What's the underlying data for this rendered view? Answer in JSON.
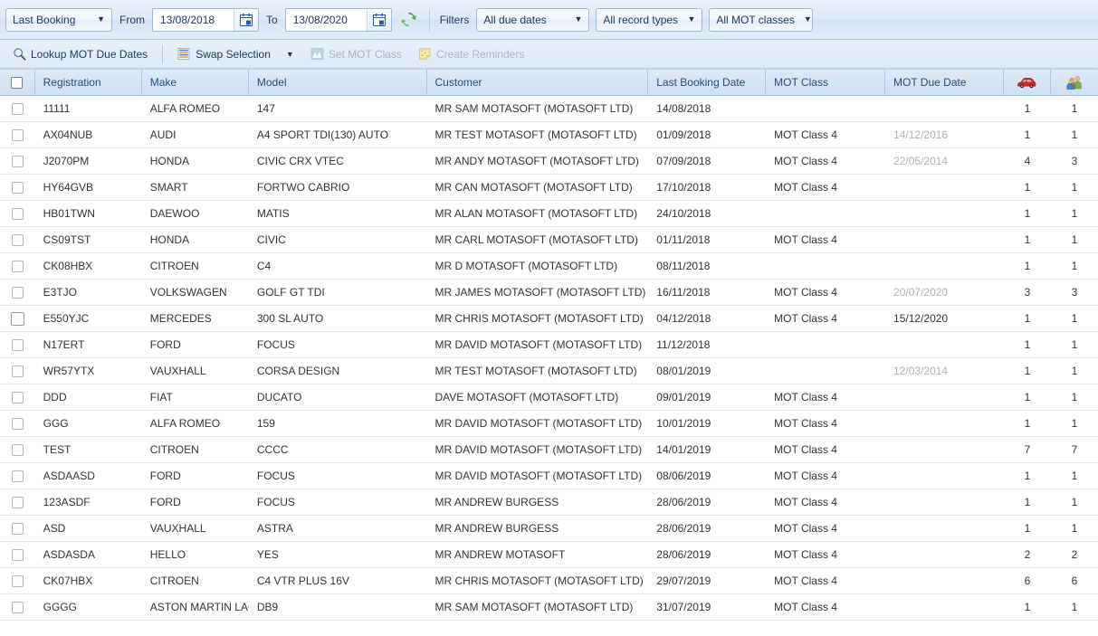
{
  "filter_bar": {
    "sort_by": {
      "value": "Last Booking",
      "icon": "chevron-down-icon"
    },
    "from_label": "From",
    "from_date": "13/08/2018",
    "to_label": "To",
    "to_date": "13/08/2020",
    "refresh_icon": "refresh-icon",
    "calendar_icon": "calendar-icon",
    "filters_label": "Filters",
    "filter_due_dates": "All due dates",
    "filter_record_types": "All record types",
    "filter_mot_classes": "All MOT classes"
  },
  "action_bar": {
    "lookup": {
      "label": "Lookup MOT Due Dates",
      "icon": "magnifier-icon",
      "disabled": false
    },
    "swap": {
      "label": "Swap Selection",
      "icon": "list-stack-icon",
      "disabled": false
    },
    "set_mot_class": {
      "label": "Set MOT Class",
      "icon": "mot-class-icon",
      "disabled": true
    },
    "create_reminders": {
      "label": "Create Reminders",
      "icon": "sticky-note-icon",
      "disabled": true
    }
  },
  "grid": {
    "columns": [
      {
        "key": "check",
        "label": "",
        "icon": "select-all-checkbox"
      },
      {
        "key": "registration",
        "label": "Registration"
      },
      {
        "key": "make",
        "label": "Make"
      },
      {
        "key": "model",
        "label": "Model"
      },
      {
        "key": "customer",
        "label": "Customer"
      },
      {
        "key": "last_booking_date",
        "label": "Last Booking Date"
      },
      {
        "key": "mot_class",
        "label": "MOT Class"
      },
      {
        "key": "mot_due_date",
        "label": "MOT Due Date"
      },
      {
        "key": "vehicles",
        "label": "",
        "icon": "car-icon"
      },
      {
        "key": "customers",
        "label": "",
        "icon": "people-icon"
      }
    ],
    "rows": [
      {
        "registration": "11111",
        "make": "ALFA ROMEO",
        "model": "147",
        "customer": "MR SAM MOTASOFT (MOTASOFT LTD)",
        "last_booking_date": "14/08/2018",
        "mot_class": "",
        "mot_due_date": "",
        "mot_due_past": false,
        "vehicles": "1",
        "customers": "1",
        "checked": false,
        "focused": false
      },
      {
        "registration": "AX04NUB",
        "make": "AUDI",
        "model": "A4 SPORT TDI(130) AUTO",
        "customer": "MR TEST MOTASOFT (MOTASOFT LTD)",
        "last_booking_date": "01/09/2018",
        "mot_class": "MOT Class 4",
        "mot_due_date": "14/12/2016",
        "mot_due_past": true,
        "vehicles": "1",
        "customers": "1",
        "checked": false,
        "focused": false
      },
      {
        "registration": "J2070PM",
        "make": "HONDA",
        "model": "CIVIC CRX VTEC",
        "customer": "MR ANDY MOTASOFT (MOTASOFT LTD)",
        "last_booking_date": "07/09/2018",
        "mot_class": "MOT Class 4",
        "mot_due_date": "22/05/2014",
        "mot_due_past": true,
        "vehicles": "4",
        "customers": "3",
        "checked": false,
        "focused": false
      },
      {
        "registration": "HY64GVB",
        "make": "SMART",
        "model": "FORTWO CABRIO",
        "customer": "MR CAN MOTASOFT (MOTASOFT LTD)",
        "last_booking_date": "17/10/2018",
        "mot_class": "MOT Class 4",
        "mot_due_date": "",
        "mot_due_past": false,
        "vehicles": "1",
        "customers": "1",
        "checked": false,
        "focused": false
      },
      {
        "registration": "HB01TWN",
        "make": "DAEWOO",
        "model": "MATIS",
        "customer": "MR ALAN MOTASOFT (MOTASOFT LTD)",
        "last_booking_date": "24/10/2018",
        "mot_class": "",
        "mot_due_date": "",
        "mot_due_past": false,
        "vehicles": "1",
        "customers": "1",
        "checked": false,
        "focused": false
      },
      {
        "registration": "CS09TST",
        "make": "HONDA",
        "model": "CIVIC",
        "customer": "MR CARL MOTASOFT (MOTASOFT LTD)",
        "last_booking_date": "01/11/2018",
        "mot_class": "MOT Class 4",
        "mot_due_date": "",
        "mot_due_past": false,
        "vehicles": "1",
        "customers": "1",
        "checked": false,
        "focused": false
      },
      {
        "registration": "CK08HBX",
        "make": "CITROEN",
        "model": "C4",
        "customer": "MR D MOTASOFT (MOTASOFT LTD)",
        "last_booking_date": "08/11/2018",
        "mot_class": "",
        "mot_due_date": "",
        "mot_due_past": false,
        "vehicles": "1",
        "customers": "1",
        "checked": false,
        "focused": false
      },
      {
        "registration": "E3TJO",
        "make": "VOLKSWAGEN",
        "model": "GOLF GT TDI",
        "customer": "MR JAMES MOTASOFT (MOTASOFT LTD)",
        "last_booking_date": "16/11/2018",
        "mot_class": "MOT Class 4",
        "mot_due_date": "20/07/2020",
        "mot_due_past": true,
        "vehicles": "3",
        "customers": "3",
        "checked": false,
        "focused": false
      },
      {
        "registration": "E550YJC",
        "make": "MERCEDES",
        "model": "300 SL AUTO",
        "customer": "MR CHRIS MOTASOFT (MOTASOFT LTD)",
        "last_booking_date": "04/12/2018",
        "mot_class": "MOT Class 4",
        "mot_due_date": "15/12/2020",
        "mot_due_past": false,
        "vehicles": "1",
        "customers": "1",
        "checked": false,
        "focused": true
      },
      {
        "registration": "N17ERT",
        "make": "FORD",
        "model": "FOCUS",
        "customer": "MR DAVID MOTASOFT (MOTASOFT LTD)",
        "last_booking_date": "11/12/2018",
        "mot_class": "",
        "mot_due_date": "",
        "mot_due_past": false,
        "vehicles": "1",
        "customers": "1",
        "checked": false,
        "focused": false
      },
      {
        "registration": "WR57YTX",
        "make": "VAUXHALL",
        "model": "CORSA DESIGN",
        "customer": "MR TEST MOTASOFT (MOTASOFT LTD)",
        "last_booking_date": "08/01/2019",
        "mot_class": "",
        "mot_due_date": "12/03/2014",
        "mot_due_past": true,
        "vehicles": "1",
        "customers": "1",
        "checked": false,
        "focused": false
      },
      {
        "registration": "DDD",
        "make": "FIAT",
        "model": "DUCATO",
        "customer": "DAVE MOTASOFT (MOTASOFT LTD)",
        "last_booking_date": "09/01/2019",
        "mot_class": "MOT Class 4",
        "mot_due_date": "",
        "mot_due_past": false,
        "vehicles": "1",
        "customers": "1",
        "checked": false,
        "focused": false
      },
      {
        "registration": "GGG",
        "make": "ALFA ROMEO",
        "model": "159",
        "customer": "MR DAVID MOTASOFT (MOTASOFT LTD)",
        "last_booking_date": "10/01/2019",
        "mot_class": "MOT Class 4",
        "mot_due_date": "",
        "mot_due_past": false,
        "vehicles": "1",
        "customers": "1",
        "checked": false,
        "focused": false
      },
      {
        "registration": "TEST",
        "make": "CITROEN",
        "model": "CCCC",
        "customer": "MR DAVID MOTASOFT (MOTASOFT LTD)",
        "last_booking_date": "14/01/2019",
        "mot_class": "MOT Class 4",
        "mot_due_date": "",
        "mot_due_past": false,
        "vehicles": "7",
        "customers": "7",
        "checked": false,
        "focused": false
      },
      {
        "registration": "ASDAASD",
        "make": "FORD",
        "model": "FOCUS",
        "customer": "MR DAVID MOTASOFT (MOTASOFT LTD)",
        "last_booking_date": "08/06/2019",
        "mot_class": "MOT Class 4",
        "mot_due_date": "",
        "mot_due_past": false,
        "vehicles": "1",
        "customers": "1",
        "checked": false,
        "focused": false
      },
      {
        "registration": "123ASDF",
        "make": "FORD",
        "model": "FOCUS",
        "customer": "MR ANDREW BURGESS",
        "last_booking_date": "28/06/2019",
        "mot_class": "MOT Class 4",
        "mot_due_date": "",
        "mot_due_past": false,
        "vehicles": "1",
        "customers": "1",
        "checked": false,
        "focused": false
      },
      {
        "registration": "ASD",
        "make": "VAUXHALL",
        "model": "ASTRA",
        "customer": "MR ANDREW BURGESS",
        "last_booking_date": "28/06/2019",
        "mot_class": "MOT Class 4",
        "mot_due_date": "",
        "mot_due_past": false,
        "vehicles": "1",
        "customers": "1",
        "checked": false,
        "focused": false
      },
      {
        "registration": "ASDASDA",
        "make": "HELLO",
        "model": "YES",
        "customer": "MR ANDREW MOTASOFT",
        "last_booking_date": "28/06/2019",
        "mot_class": "MOT Class 4",
        "mot_due_date": "",
        "mot_due_past": false,
        "vehicles": "2",
        "customers": "2",
        "checked": false,
        "focused": false
      },
      {
        "registration": "CK07HBX",
        "make": "CITROEN",
        "model": "C4 VTR PLUS 16V",
        "customer": "MR CHRIS MOTASOFT (MOTASOFT LTD)",
        "last_booking_date": "29/07/2019",
        "mot_class": "MOT Class 4",
        "mot_due_date": "",
        "mot_due_past": false,
        "vehicles": "6",
        "customers": "6",
        "checked": false,
        "focused": false
      },
      {
        "registration": "GGGG",
        "make": "ASTON MARTIN LAGONDA",
        "model": "DB9",
        "customer": "MR SAM MOTASOFT (MOTASOFT LTD)",
        "last_booking_date": "31/07/2019",
        "mot_class": "MOT Class 4",
        "mot_due_date": "",
        "mot_due_past": false,
        "vehicles": "1",
        "customers": "1",
        "checked": false,
        "focused": false
      }
    ]
  },
  "colors": {
    "header_text": "#2b4a77",
    "accent": "#1f3864",
    "muted_date": "#b2b2b2",
    "car_icon": "#e02b20",
    "refresh_icon": "#4f9f3e"
  }
}
